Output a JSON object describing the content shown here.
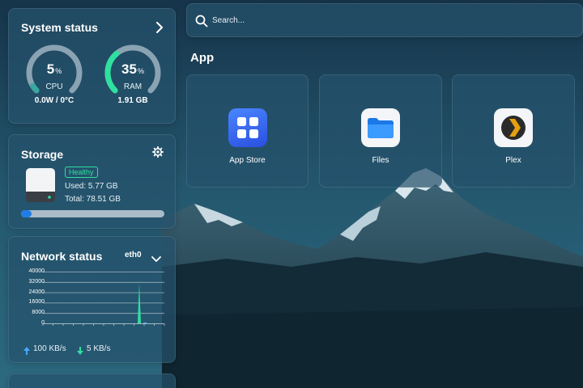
{
  "search": {
    "placeholder": "Search..."
  },
  "system_status": {
    "title": "System status",
    "cpu": {
      "value": "5",
      "unit": "%",
      "label": "CPU",
      "sub": "0.0W / 0°C",
      "fraction": 0.05,
      "color": "#3aa7a0"
    },
    "ram": {
      "value": "35",
      "unit": "%",
      "label": "RAM",
      "sub": "1.91 GB",
      "fraction": 0.35,
      "color": "#2fe0a0"
    }
  },
  "storage": {
    "title": "Storage",
    "badge": "Healthy",
    "used": "Used: 5.77 GB",
    "total": "Total: 78.51 GB",
    "fraction": 0.0735,
    "bar_color": "#1f7de6"
  },
  "network": {
    "title": "Network status",
    "interface": "eth0",
    "y_ticks": [
      "40000",
      "32000",
      "24000",
      "16000",
      "8000",
      "0"
    ],
    "upload": "100 KB/s",
    "download": "5 KB/s",
    "spike_value": 31000,
    "y_max": 40000
  },
  "app_section": {
    "title": "App",
    "apps": [
      {
        "label": "App Store",
        "icon": "app-store-icon"
      },
      {
        "label": "Files",
        "icon": "folder-icon"
      },
      {
        "label": "Plex",
        "icon": "plex-icon"
      }
    ]
  },
  "colors": {
    "accent": "#2fe0a0",
    "upload_arrow": "#4aa8ff",
    "download_arrow": "#2fe0a0"
  }
}
